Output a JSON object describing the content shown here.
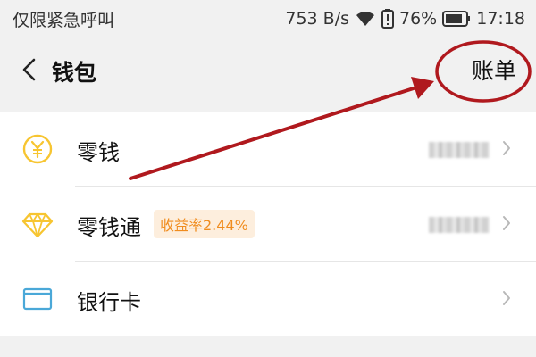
{
  "status_bar": {
    "carrier": "仅限紧急呼叫",
    "speed": "753 B/s",
    "battery_percent": "76%",
    "time": "17:18",
    "icons": [
      "wifi-icon",
      "alert-battery-icon",
      "battery-icon"
    ]
  },
  "nav": {
    "title": "钱包",
    "bill_label": "账单",
    "back_icon": "chevron-left-icon"
  },
  "list": {
    "items": [
      {
        "label": "零钱",
        "icon": "yen-coin-icon"
      },
      {
        "label": "零钱通",
        "icon": "diamond-icon",
        "badge": "收益率2.44%"
      },
      {
        "label": "银行卡",
        "icon": "bank-card-icon"
      }
    ]
  },
  "colors": {
    "background": "#f1f1f1",
    "icon_yellow": "#f7c531",
    "card_blue": "#4aa8d8",
    "badge_bg": "#fdeedd",
    "badge_text": "#f08c1e",
    "annotation_red": "#b0191e"
  }
}
